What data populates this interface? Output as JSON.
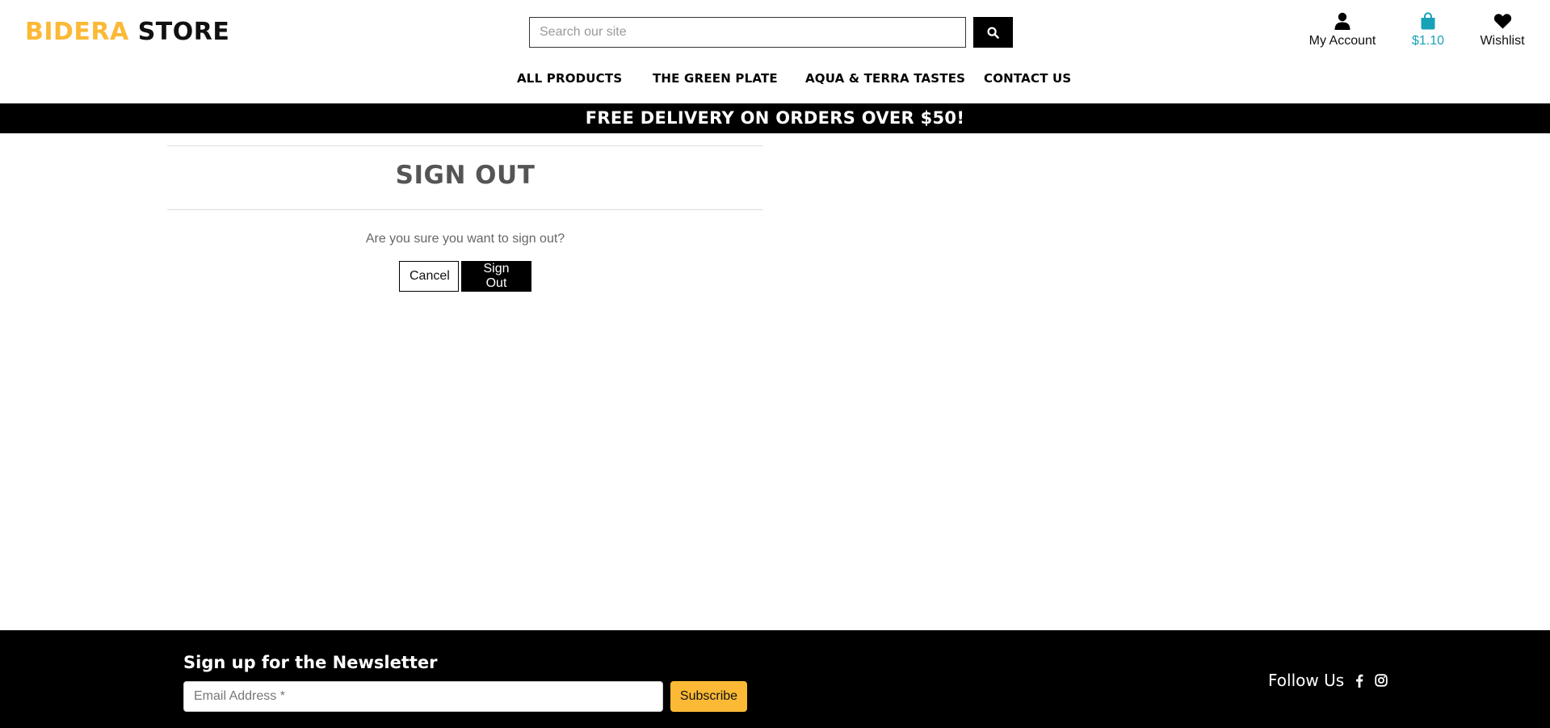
{
  "header": {
    "logo": {
      "brand": "BIDERA",
      "store": "STORE"
    },
    "search": {
      "placeholder": "Search our site",
      "value": ""
    },
    "account_label": "My Account",
    "bag_total": "$1.10",
    "wishlist_label": "Wishlist",
    "nav": [
      {
        "label": "All Products"
      },
      {
        "label": "The Green Plate"
      },
      {
        "label": "Aqua & Terra Tastes"
      },
      {
        "label": "Contact Us"
      }
    ]
  },
  "banner": {
    "text": "Free delivery on orders over $50!"
  },
  "main": {
    "title": "Sign Out",
    "confirm_text": "Are you sure you want to sign out?",
    "cancel_label": "Cancel",
    "signout_label": "Sign Out"
  },
  "footer": {
    "newsletter_title": "Sign up for the Newsletter",
    "email_placeholder": "Email Address *",
    "email_value": "",
    "subscribe_label": "Subscribe",
    "follow_label": "Follow Us",
    "social_icons": [
      "facebook-icon",
      "instagram-icon"
    ]
  },
  "colors": {
    "brand_yellow": "#fbb936",
    "bag_teal": "#17a2b8",
    "banner_bg": "#000000",
    "footer_bg": "#000000"
  }
}
